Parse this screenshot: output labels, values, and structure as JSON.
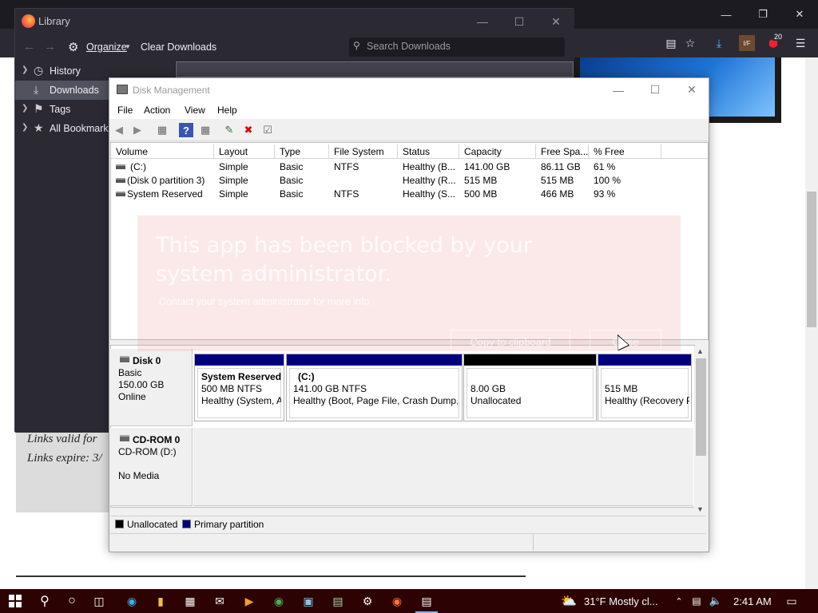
{
  "browser": {
    "notifications_badge": "20",
    "extension_label": "I/F"
  },
  "page": {
    "links_valid": "Links valid for",
    "links_expire": "Links expire: 3/"
  },
  "library": {
    "title": "Library",
    "organize": "Organize",
    "clear_downloads": "Clear Downloads",
    "search_placeholder": "Search Downloads",
    "sidebar": [
      {
        "label": "History",
        "icon": "clock-icon"
      },
      {
        "label": "Downloads",
        "icon": "download-icon"
      },
      {
        "label": "Tags",
        "icon": "tag-icon"
      },
      {
        "label": "All Bookmarks",
        "icon": "star-icon"
      }
    ]
  },
  "disk_mgmt": {
    "title": "Disk Management",
    "menu": [
      "File",
      "Action",
      "View",
      "Help"
    ],
    "columns": [
      "Volume",
      "Layout",
      "Type",
      "File System",
      "Status",
      "Capacity",
      "Free Spa...",
      "% Free"
    ],
    "volumes": [
      {
        "volume": "(C:)",
        "layout": "Simple",
        "type": "Basic",
        "fs": "NTFS",
        "status": "Healthy (B...",
        "capacity": "141.00 GB",
        "free": "86.11 GB",
        "pct": "61 %"
      },
      {
        "volume": "(Disk 0 partition 3)",
        "layout": "Simple",
        "type": "Basic",
        "fs": "",
        "status": "Healthy (R...",
        "capacity": "515 MB",
        "free": "515 MB",
        "pct": "100 %"
      },
      {
        "volume": "System Reserved",
        "layout": "Simple",
        "type": "Basic",
        "fs": "NTFS",
        "status": "Healthy (S...",
        "capacity": "500 MB",
        "free": "466 MB",
        "pct": "93 %"
      }
    ],
    "blocked": {
      "title": "This app has been blocked by your system administrator.",
      "subtitle": "Contact your system administrator for more info.",
      "copy_button": "Copy to clipboard",
      "close_button": "Close"
    },
    "disk0": {
      "name": "Disk 0",
      "type": "Basic",
      "size": "150.00 GB",
      "status": "Online",
      "partitions": [
        {
          "name": "System Reserved",
          "size": "500 MB NTFS",
          "status": "Healthy (System, A",
          "color": "#00007f"
        },
        {
          "name": "(C:)",
          "size": "141.00 GB NTFS",
          "status": "Healthy (Boot, Page File, Crash Dump, I",
          "color": "#00007f"
        },
        {
          "name": "",
          "size": "8.00 GB",
          "status": "Unallocated",
          "color": "#000000"
        },
        {
          "name": "",
          "size": "515 MB",
          "status": "Healthy (Recovery P",
          "color": "#00007f"
        }
      ]
    },
    "cdrom": {
      "name": "CD-ROM 0",
      "drive": "CD-ROM (D:)",
      "media": "No Media"
    },
    "legend": [
      {
        "label": "Unallocated",
        "color": "#000000"
      },
      {
        "label": "Primary partition",
        "color": "#00007f"
      }
    ]
  },
  "taskbar": {
    "weather": "31°F  Mostly cl...",
    "time": "2:41 AM"
  }
}
